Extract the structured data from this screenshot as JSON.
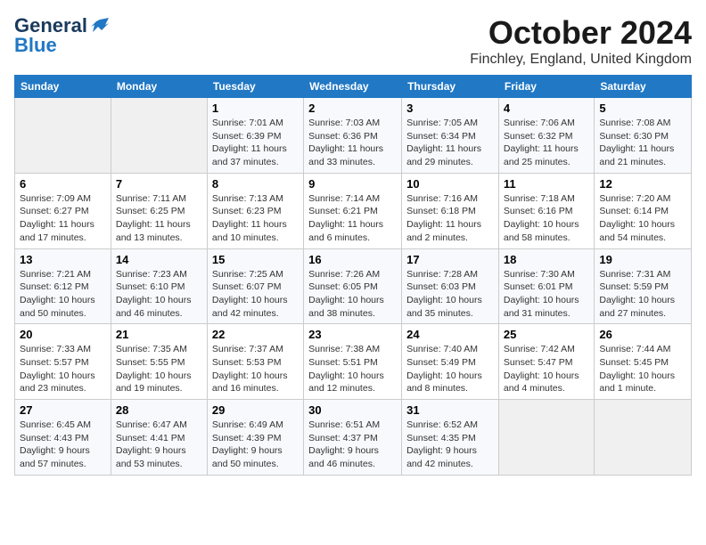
{
  "header": {
    "logo_general": "General",
    "logo_blue": "Blue",
    "month": "October 2024",
    "location": "Finchley, England, United Kingdom"
  },
  "days_of_week": [
    "Sunday",
    "Monday",
    "Tuesday",
    "Wednesday",
    "Thursday",
    "Friday",
    "Saturday"
  ],
  "weeks": [
    [
      {
        "day": "",
        "info": ""
      },
      {
        "day": "",
        "info": ""
      },
      {
        "day": "1",
        "info": "Sunrise: 7:01 AM\nSunset: 6:39 PM\nDaylight: 11 hours\nand 37 minutes."
      },
      {
        "day": "2",
        "info": "Sunrise: 7:03 AM\nSunset: 6:36 PM\nDaylight: 11 hours\nand 33 minutes."
      },
      {
        "day": "3",
        "info": "Sunrise: 7:05 AM\nSunset: 6:34 PM\nDaylight: 11 hours\nand 29 minutes."
      },
      {
        "day": "4",
        "info": "Sunrise: 7:06 AM\nSunset: 6:32 PM\nDaylight: 11 hours\nand 25 minutes."
      },
      {
        "day": "5",
        "info": "Sunrise: 7:08 AM\nSunset: 6:30 PM\nDaylight: 11 hours\nand 21 minutes."
      }
    ],
    [
      {
        "day": "6",
        "info": "Sunrise: 7:09 AM\nSunset: 6:27 PM\nDaylight: 11 hours\nand 17 minutes."
      },
      {
        "day": "7",
        "info": "Sunrise: 7:11 AM\nSunset: 6:25 PM\nDaylight: 11 hours\nand 13 minutes."
      },
      {
        "day": "8",
        "info": "Sunrise: 7:13 AM\nSunset: 6:23 PM\nDaylight: 11 hours\nand 10 minutes."
      },
      {
        "day": "9",
        "info": "Sunrise: 7:14 AM\nSunset: 6:21 PM\nDaylight: 11 hours\nand 6 minutes."
      },
      {
        "day": "10",
        "info": "Sunrise: 7:16 AM\nSunset: 6:18 PM\nDaylight: 11 hours\nand 2 minutes."
      },
      {
        "day": "11",
        "info": "Sunrise: 7:18 AM\nSunset: 6:16 PM\nDaylight: 10 hours\nand 58 minutes."
      },
      {
        "day": "12",
        "info": "Sunrise: 7:20 AM\nSunset: 6:14 PM\nDaylight: 10 hours\nand 54 minutes."
      }
    ],
    [
      {
        "day": "13",
        "info": "Sunrise: 7:21 AM\nSunset: 6:12 PM\nDaylight: 10 hours\nand 50 minutes."
      },
      {
        "day": "14",
        "info": "Sunrise: 7:23 AM\nSunset: 6:10 PM\nDaylight: 10 hours\nand 46 minutes."
      },
      {
        "day": "15",
        "info": "Sunrise: 7:25 AM\nSunset: 6:07 PM\nDaylight: 10 hours\nand 42 minutes."
      },
      {
        "day": "16",
        "info": "Sunrise: 7:26 AM\nSunset: 6:05 PM\nDaylight: 10 hours\nand 38 minutes."
      },
      {
        "day": "17",
        "info": "Sunrise: 7:28 AM\nSunset: 6:03 PM\nDaylight: 10 hours\nand 35 minutes."
      },
      {
        "day": "18",
        "info": "Sunrise: 7:30 AM\nSunset: 6:01 PM\nDaylight: 10 hours\nand 31 minutes."
      },
      {
        "day": "19",
        "info": "Sunrise: 7:31 AM\nSunset: 5:59 PM\nDaylight: 10 hours\nand 27 minutes."
      }
    ],
    [
      {
        "day": "20",
        "info": "Sunrise: 7:33 AM\nSunset: 5:57 PM\nDaylight: 10 hours\nand 23 minutes."
      },
      {
        "day": "21",
        "info": "Sunrise: 7:35 AM\nSunset: 5:55 PM\nDaylight: 10 hours\nand 19 minutes."
      },
      {
        "day": "22",
        "info": "Sunrise: 7:37 AM\nSunset: 5:53 PM\nDaylight: 10 hours\nand 16 minutes."
      },
      {
        "day": "23",
        "info": "Sunrise: 7:38 AM\nSunset: 5:51 PM\nDaylight: 10 hours\nand 12 minutes."
      },
      {
        "day": "24",
        "info": "Sunrise: 7:40 AM\nSunset: 5:49 PM\nDaylight: 10 hours\nand 8 minutes."
      },
      {
        "day": "25",
        "info": "Sunrise: 7:42 AM\nSunset: 5:47 PM\nDaylight: 10 hours\nand 4 minutes."
      },
      {
        "day": "26",
        "info": "Sunrise: 7:44 AM\nSunset: 5:45 PM\nDaylight: 10 hours\nand 1 minute."
      }
    ],
    [
      {
        "day": "27",
        "info": "Sunrise: 6:45 AM\nSunset: 4:43 PM\nDaylight: 9 hours\nand 57 minutes."
      },
      {
        "day": "28",
        "info": "Sunrise: 6:47 AM\nSunset: 4:41 PM\nDaylight: 9 hours\nand 53 minutes."
      },
      {
        "day": "29",
        "info": "Sunrise: 6:49 AM\nSunset: 4:39 PM\nDaylight: 9 hours\nand 50 minutes."
      },
      {
        "day": "30",
        "info": "Sunrise: 6:51 AM\nSunset: 4:37 PM\nDaylight: 9 hours\nand 46 minutes."
      },
      {
        "day": "31",
        "info": "Sunrise: 6:52 AM\nSunset: 4:35 PM\nDaylight: 9 hours\nand 42 minutes."
      },
      {
        "day": "",
        "info": ""
      },
      {
        "day": "",
        "info": ""
      }
    ]
  ]
}
